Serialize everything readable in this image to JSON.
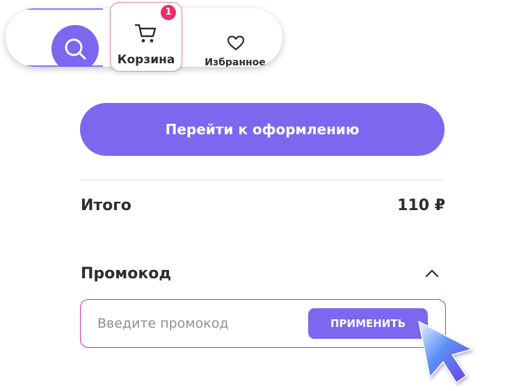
{
  "header": {
    "cart_label": "Корзина",
    "cart_badge": "1",
    "favorites_label": "Избранное",
    "icons": [
      "search-icon",
      "cart-icon",
      "heart-icon"
    ]
  },
  "checkout": {
    "button_label": "Перейти к оформлению"
  },
  "total": {
    "label": "Итого",
    "value": "110 ₽"
  },
  "promo": {
    "title": "Промокод",
    "placeholder": "Введите промокод",
    "apply_label": "ПРИМЕНИТЬ",
    "expanded": true
  },
  "colors": {
    "accent": "#7c67ee",
    "badge": "#ec2d6b",
    "promo_border": "#d12c8f",
    "text": "#2b2d33",
    "placeholder": "#8e8f96"
  }
}
